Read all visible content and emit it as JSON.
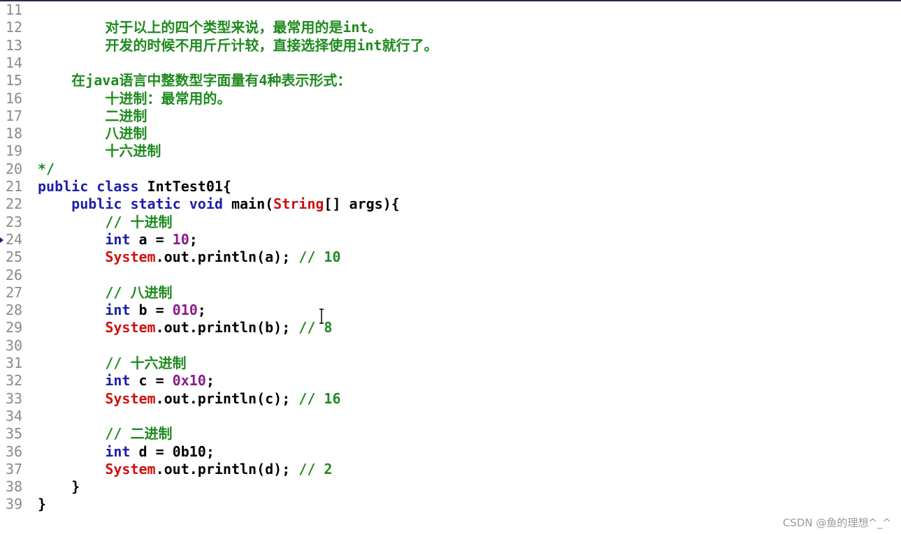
{
  "editor": {
    "lines": [
      {
        "n": "11",
        "segs": []
      },
      {
        "n": "12",
        "segs": [
          {
            "t": "        ",
            "c": "ws"
          },
          {
            "t": "对于以上的四个类型来说，最常用的是int。",
            "c": "comment"
          }
        ]
      },
      {
        "n": "13",
        "segs": [
          {
            "t": "        ",
            "c": "ws"
          },
          {
            "t": "开发的时候不用斤斤计较，直接选择使用int就行了。",
            "c": "comment"
          }
        ]
      },
      {
        "n": "14",
        "segs": []
      },
      {
        "n": "15",
        "segs": [
          {
            "t": "    ",
            "c": "ws"
          },
          {
            "t": "在java语言中整数型字面量有4种表示形式：",
            "c": "comment"
          }
        ]
      },
      {
        "n": "16",
        "segs": [
          {
            "t": "        ",
            "c": "ws"
          },
          {
            "t": "十进制：最常用的。",
            "c": "comment"
          }
        ]
      },
      {
        "n": "17",
        "segs": [
          {
            "t": "        ",
            "c": "ws"
          },
          {
            "t": "二进制",
            "c": "comment"
          }
        ]
      },
      {
        "n": "18",
        "segs": [
          {
            "t": "        ",
            "c": "ws"
          },
          {
            "t": "八进制",
            "c": "comment"
          }
        ]
      },
      {
        "n": "19",
        "segs": [
          {
            "t": "        ",
            "c": "ws"
          },
          {
            "t": "十六进制",
            "c": "comment"
          }
        ]
      },
      {
        "n": "20",
        "segs": [
          {
            "t": "*/",
            "c": "comment"
          }
        ]
      },
      {
        "n": "21",
        "segs": [
          {
            "t": "public class ",
            "c": "keyword"
          },
          {
            "t": "IntTest01{",
            "c": "plain"
          }
        ]
      },
      {
        "n": "22",
        "segs": [
          {
            "t": "    ",
            "c": "ws"
          },
          {
            "t": "public static void ",
            "c": "keyword"
          },
          {
            "t": "main(",
            "c": "plain"
          },
          {
            "t": "String",
            "c": "string-class"
          },
          {
            "t": "[] args){",
            "c": "plain"
          }
        ]
      },
      {
        "n": "23",
        "segs": [
          {
            "t": "        ",
            "c": "ws"
          },
          {
            "t": "// 十进制",
            "c": "comment"
          }
        ]
      },
      {
        "n": "24",
        "marker": true,
        "segs": [
          {
            "t": "        ",
            "c": "ws"
          },
          {
            "t": "int ",
            "c": "keyword"
          },
          {
            "t": "a = ",
            "c": "plain"
          },
          {
            "t": "10",
            "c": "number"
          },
          {
            "t": ";",
            "c": "plain"
          }
        ]
      },
      {
        "n": "25",
        "segs": [
          {
            "t": "        ",
            "c": "ws"
          },
          {
            "t": "System",
            "c": "string-class"
          },
          {
            "t": ".out.println(a); ",
            "c": "plain"
          },
          {
            "t": "// 10",
            "c": "comment"
          }
        ]
      },
      {
        "n": "26",
        "segs": []
      },
      {
        "n": "27",
        "segs": [
          {
            "t": "        ",
            "c": "ws"
          },
          {
            "t": "// 八进制",
            "c": "comment"
          }
        ]
      },
      {
        "n": "28",
        "segs": [
          {
            "t": "        ",
            "c": "ws"
          },
          {
            "t": "int ",
            "c": "keyword"
          },
          {
            "t": "b = ",
            "c": "plain"
          },
          {
            "t": "010",
            "c": "number"
          },
          {
            "t": ";",
            "c": "plain"
          }
        ]
      },
      {
        "n": "29",
        "segs": [
          {
            "t": "        ",
            "c": "ws"
          },
          {
            "t": "System",
            "c": "string-class"
          },
          {
            "t": ".out.println(b); ",
            "c": "plain"
          },
          {
            "t": "// 8",
            "c": "comment"
          }
        ]
      },
      {
        "n": "30",
        "segs": []
      },
      {
        "n": "31",
        "segs": [
          {
            "t": "        ",
            "c": "ws"
          },
          {
            "t": "// 十六进制",
            "c": "comment"
          }
        ]
      },
      {
        "n": "32",
        "segs": [
          {
            "t": "        ",
            "c": "ws"
          },
          {
            "t": "int ",
            "c": "keyword"
          },
          {
            "t": "c = ",
            "c": "plain"
          },
          {
            "t": "0x10",
            "c": "number"
          },
          {
            "t": ";",
            "c": "plain"
          }
        ]
      },
      {
        "n": "33",
        "segs": [
          {
            "t": "        ",
            "c": "ws"
          },
          {
            "t": "System",
            "c": "string-class"
          },
          {
            "t": ".out.println(c); ",
            "c": "plain"
          },
          {
            "t": "// 16",
            "c": "comment"
          }
        ]
      },
      {
        "n": "34",
        "segs": []
      },
      {
        "n": "35",
        "segs": [
          {
            "t": "        ",
            "c": "ws"
          },
          {
            "t": "// 二进制",
            "c": "comment"
          }
        ]
      },
      {
        "n": "36",
        "segs": [
          {
            "t": "        ",
            "c": "ws"
          },
          {
            "t": "int ",
            "c": "keyword"
          },
          {
            "t": "d = 0b10;",
            "c": "plain"
          }
        ]
      },
      {
        "n": "37",
        "segs": [
          {
            "t": "        ",
            "c": "ws"
          },
          {
            "t": "System",
            "c": "string-class"
          },
          {
            "t": ".out.println(d); ",
            "c": "plain"
          },
          {
            "t": "// 2",
            "c": "comment"
          }
        ]
      },
      {
        "n": "38",
        "segs": [
          {
            "t": "    ",
            "c": "ws"
          },
          {
            "t": "}",
            "c": "plain"
          }
        ]
      },
      {
        "n": "39",
        "segs": [
          {
            "t": "}",
            "c": "plain"
          }
        ]
      }
    ]
  },
  "watermark": "CSDN @鱼的理想^_^",
  "colors": {
    "comment": "#1f8a1f",
    "keyword": "#1e1ea8",
    "class": "#d01010",
    "number": "#8a1c8a",
    "gutter": "#8a8a8a"
  },
  "icons": {
    "cursor": "ibeam-cursor-icon",
    "breakpoint": "current-line-marker-icon"
  }
}
